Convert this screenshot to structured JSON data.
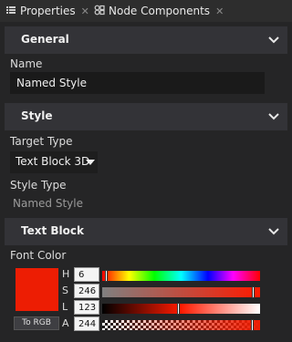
{
  "tabs": [
    {
      "label": "Properties",
      "close": "✕"
    },
    {
      "label": "Node Components",
      "close": "✕"
    }
  ],
  "sections": {
    "general": "General",
    "style": "Style",
    "text_block": "Text Block"
  },
  "fields": {
    "name_label": "Name",
    "name_value": "Named Style",
    "target_type_label": "Target Type",
    "target_type_value": "Text Block 3D",
    "style_type_label": "Style Type",
    "style_type_value": "Named Style",
    "font_color_label": "Font Color"
  },
  "color_picker": {
    "swatch_color": "#ed1d03",
    "to_rgb_label": "To RGB",
    "channels": [
      {
        "label": "H",
        "value": "6",
        "level": 0.017
      },
      {
        "label": "S",
        "value": "246",
        "level": 0.965
      },
      {
        "label": "L",
        "value": "123",
        "level": 0.482
      },
      {
        "label": "A",
        "value": "244",
        "level": 0.957
      }
    ]
  }
}
